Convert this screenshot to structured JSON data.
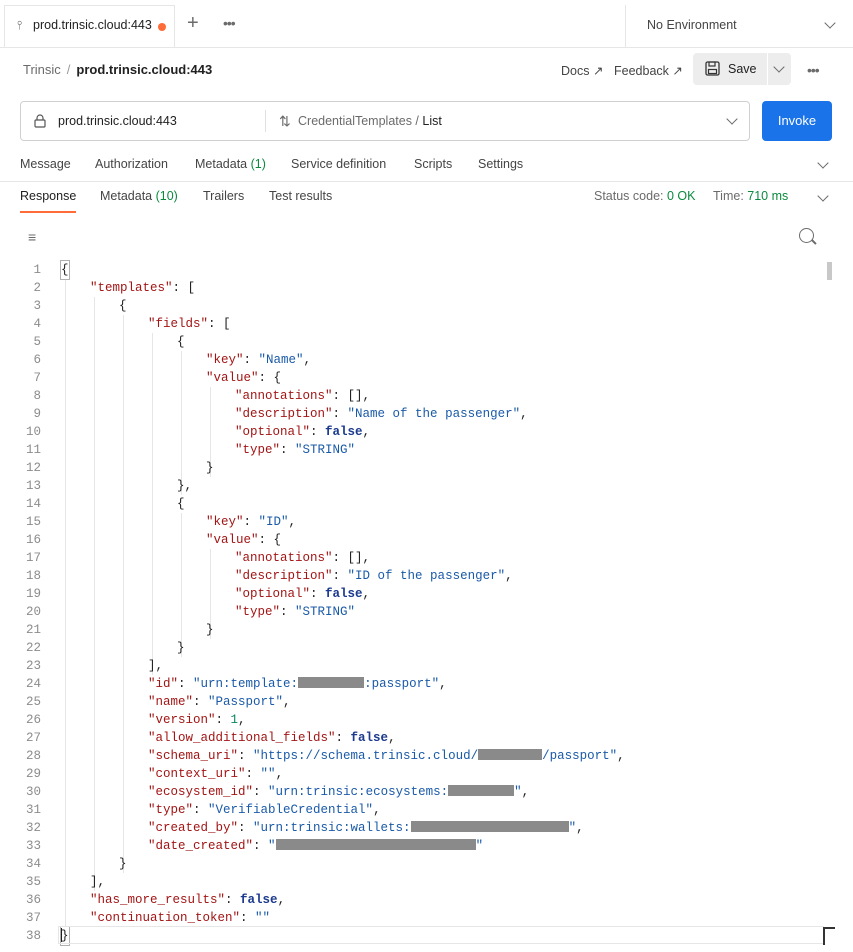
{
  "tab": {
    "label": "prod.trinsic.cloud:443",
    "icon": "grpc-icon"
  },
  "environment": {
    "label": "No Environment"
  },
  "breadcrumb": {
    "parent": "Trinsic",
    "current": "prod.trinsic.cloud:443"
  },
  "header_actions": {
    "docs": "Docs ↗",
    "feedback": "Feedback ↗",
    "save": "Save"
  },
  "request": {
    "url": "prod.trinsic.cloud:443",
    "service": "CredentialTemplates / ",
    "method": "List",
    "invoke": "Invoke"
  },
  "request_tabs": {
    "message": "Message",
    "authorization": "Authorization",
    "metadata": "Metadata",
    "metadata_count": "(1)",
    "service_definition": "Service definition",
    "scripts": "Scripts",
    "settings": "Settings"
  },
  "response_tabs": {
    "response": "Response",
    "metadata": "Metadata",
    "metadata_count": "(10)",
    "trailers": "Trailers",
    "test_results": "Test results"
  },
  "status": {
    "label": "Status code:",
    "value": "0 OK",
    "time_label": "Time:",
    "time_value": "710 ms"
  },
  "colors": {
    "accent": "#ff6c37",
    "primary": "#1a73e8",
    "success": "#0b8a3e"
  },
  "code_lines": [
    {
      "i": 0,
      "t": [
        [
          "p",
          "{"
        ]
      ]
    },
    {
      "i": 1,
      "t": [
        [
          "k",
          "\"templates\""
        ],
        [
          "p",
          ": ["
        ]
      ]
    },
    {
      "i": 2,
      "t": [
        [
          "p",
          "{"
        ]
      ]
    },
    {
      "i": 3,
      "t": [
        [
          "k",
          "\"fields\""
        ],
        [
          "p",
          ": ["
        ]
      ]
    },
    {
      "i": 4,
      "t": [
        [
          "p",
          "{"
        ]
      ]
    },
    {
      "i": 5,
      "t": [
        [
          "k",
          "\"key\""
        ],
        [
          "p",
          ": "
        ],
        [
          "s",
          "\"Name\""
        ],
        [
          "p",
          ","
        ]
      ]
    },
    {
      "i": 5,
      "t": [
        [
          "k",
          "\"value\""
        ],
        [
          "p",
          ": {"
        ]
      ]
    },
    {
      "i": 6,
      "t": [
        [
          "k",
          "\"annotations\""
        ],
        [
          "p",
          ": [],"
        ]
      ]
    },
    {
      "i": 6,
      "t": [
        [
          "k",
          "\"description\""
        ],
        [
          "p",
          ": "
        ],
        [
          "s",
          "\"Name of the passenger\""
        ],
        [
          "p",
          ","
        ]
      ]
    },
    {
      "i": 6,
      "t": [
        [
          "k",
          "\"optional\""
        ],
        [
          "p",
          ": "
        ],
        [
          "b",
          "false"
        ],
        [
          "p",
          ","
        ]
      ]
    },
    {
      "i": 6,
      "t": [
        [
          "k",
          "\"type\""
        ],
        [
          "p",
          ": "
        ],
        [
          "s",
          "\"STRING\""
        ]
      ]
    },
    {
      "i": 5,
      "t": [
        [
          "p",
          "}"
        ]
      ]
    },
    {
      "i": 4,
      "t": [
        [
          "p",
          "},"
        ]
      ]
    },
    {
      "i": 4,
      "t": [
        [
          "p",
          "{"
        ]
      ]
    },
    {
      "i": 5,
      "t": [
        [
          "k",
          "\"key\""
        ],
        [
          "p",
          ": "
        ],
        [
          "s",
          "\"ID\""
        ],
        [
          "p",
          ","
        ]
      ]
    },
    {
      "i": 5,
      "t": [
        [
          "k",
          "\"value\""
        ],
        [
          "p",
          ": {"
        ]
      ]
    },
    {
      "i": 6,
      "t": [
        [
          "k",
          "\"annotations\""
        ],
        [
          "p",
          ": [],"
        ]
      ]
    },
    {
      "i": 6,
      "t": [
        [
          "k",
          "\"description\""
        ],
        [
          "p",
          ": "
        ],
        [
          "s",
          "\"ID of the passenger\""
        ],
        [
          "p",
          ","
        ]
      ]
    },
    {
      "i": 6,
      "t": [
        [
          "k",
          "\"optional\""
        ],
        [
          "p",
          ": "
        ],
        [
          "b",
          "false"
        ],
        [
          "p",
          ","
        ]
      ]
    },
    {
      "i": 6,
      "t": [
        [
          "k",
          "\"type\""
        ],
        [
          "p",
          ": "
        ],
        [
          "s",
          "\"STRING\""
        ]
      ]
    },
    {
      "i": 5,
      "t": [
        [
          "p",
          "}"
        ]
      ]
    },
    {
      "i": 4,
      "t": [
        [
          "p",
          "}"
        ]
      ]
    },
    {
      "i": 3,
      "t": [
        [
          "p",
          "],"
        ]
      ]
    },
    {
      "i": 3,
      "t": [
        [
          "k",
          "\"id\""
        ],
        [
          "p",
          ": "
        ],
        [
          "s",
          "\"urn:template:"
        ],
        [
          "r",
          "66"
        ],
        [
          "s",
          ":passport\""
        ],
        [
          "p",
          ","
        ]
      ]
    },
    {
      "i": 3,
      "t": [
        [
          "k",
          "\"name\""
        ],
        [
          "p",
          ": "
        ],
        [
          "s",
          "\"Passport\""
        ],
        [
          "p",
          ","
        ]
      ]
    },
    {
      "i": 3,
      "t": [
        [
          "k",
          "\"version\""
        ],
        [
          "p",
          ": "
        ],
        [
          "n",
          "1"
        ],
        [
          "p",
          ","
        ]
      ]
    },
    {
      "i": 3,
      "t": [
        [
          "k",
          "\"allow_additional_fields\""
        ],
        [
          "p",
          ": "
        ],
        [
          "b",
          "false"
        ],
        [
          "p",
          ","
        ]
      ]
    },
    {
      "i": 3,
      "t": [
        [
          "k",
          "\"schema_uri\""
        ],
        [
          "p",
          ": "
        ],
        [
          "s",
          "\"https://schema.trinsic.cloud/"
        ],
        [
          "r",
          "64"
        ],
        [
          "s",
          "/passport\""
        ],
        [
          "p",
          ","
        ]
      ]
    },
    {
      "i": 3,
      "t": [
        [
          "k",
          "\"context_uri\""
        ],
        [
          "p",
          ": "
        ],
        [
          "s",
          "\"\""
        ],
        [
          "p",
          ","
        ]
      ]
    },
    {
      "i": 3,
      "t": [
        [
          "k",
          "\"ecosystem_id\""
        ],
        [
          "p",
          ": "
        ],
        [
          "s",
          "\"urn:trinsic:ecosystems:"
        ],
        [
          "r",
          "66"
        ],
        [
          "s",
          "\""
        ],
        [
          "p",
          ","
        ]
      ]
    },
    {
      "i": 3,
      "t": [
        [
          "k",
          "\"type\""
        ],
        [
          "p",
          ": "
        ],
        [
          "s",
          "\"VerifiableCredential\""
        ],
        [
          "p",
          ","
        ]
      ]
    },
    {
      "i": 3,
      "t": [
        [
          "k",
          "\"created_by\""
        ],
        [
          "p",
          ": "
        ],
        [
          "s",
          "\"urn:trinsic:wallets:"
        ],
        [
          "r",
          "158"
        ],
        [
          "s",
          "\""
        ],
        [
          "p",
          ","
        ]
      ]
    },
    {
      "i": 3,
      "t": [
        [
          "k",
          "\"date_created\""
        ],
        [
          "p",
          ": "
        ],
        [
          "s",
          "\""
        ],
        [
          "r",
          "200"
        ],
        [
          "s",
          "\""
        ]
      ]
    },
    {
      "i": 2,
      "t": [
        [
          "p",
          "}"
        ]
      ]
    },
    {
      "i": 1,
      "t": [
        [
          "p",
          "],"
        ]
      ]
    },
    {
      "i": 1,
      "t": [
        [
          "k",
          "\"has_more_results\""
        ],
        [
          "p",
          ": "
        ],
        [
          "b",
          "false"
        ],
        [
          "p",
          ","
        ]
      ]
    },
    {
      "i": 1,
      "t": [
        [
          "k",
          "\"continuation_token\""
        ],
        [
          "p",
          ": "
        ],
        [
          "s",
          "\"\""
        ]
      ]
    },
    {
      "i": 0,
      "t": [
        [
          "p",
          "}"
        ]
      ]
    }
  ]
}
